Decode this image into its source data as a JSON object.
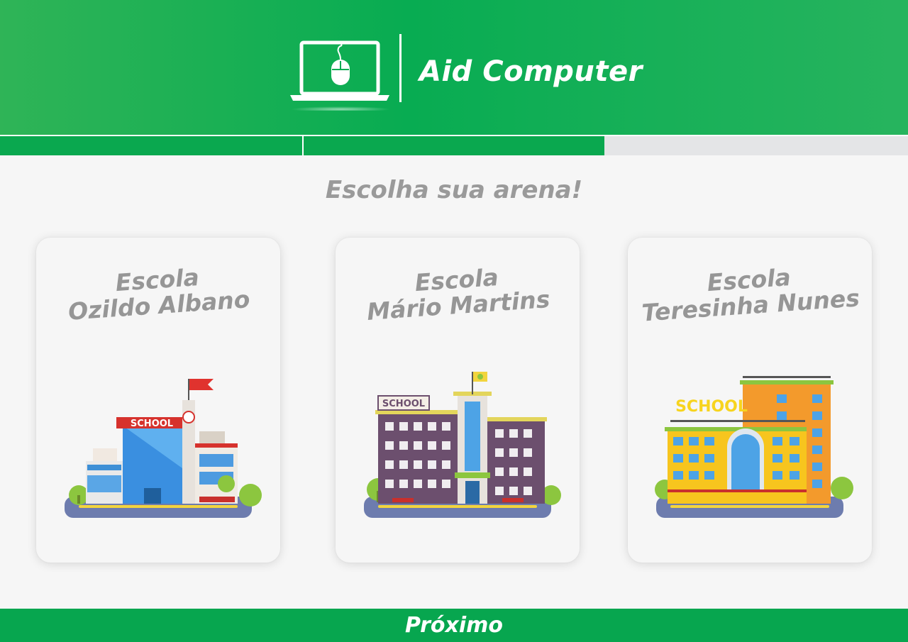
{
  "header": {
    "title": "Aid Computer",
    "logo_icon": "laptop-mouse-icon",
    "background": "#08ac52"
  },
  "progress": {
    "fraction": 0.666,
    "fill_color": "#0aa84f"
  },
  "subtitle": "Escolha sua arena!",
  "schools": [
    {
      "line1": "Escola",
      "line2": "Ozildo Albano",
      "sign": "SCHOOL",
      "icon": "school-building-blue-icon"
    },
    {
      "line1": "Escola",
      "line2": "Mário Martins",
      "sign": "SCHOOL",
      "icon": "school-building-purple-icon"
    },
    {
      "line1": "Escola",
      "line2": "Teresinha Nunes",
      "sign": "SCHOOL",
      "icon": "school-building-orange-icon"
    }
  ],
  "footer": {
    "next_label": "Próximo"
  }
}
